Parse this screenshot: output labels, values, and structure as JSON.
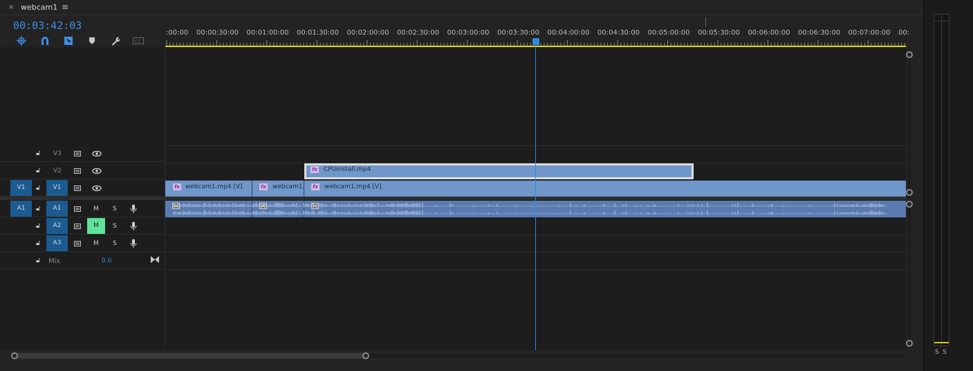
{
  "tab": {
    "title": "webcam1",
    "close_glyph": "×",
    "menu_glyph": "≡"
  },
  "timecode": "00:03:42:03",
  "toolbar_icons": [
    "nest-icon",
    "snap-magnet-icon",
    "linked-selection-icon",
    "marker-icon",
    "wrench-icon",
    "captions-icon"
  ],
  "ruler": {
    "ticks": [
      ":00:00",
      "00:00:30:00",
      "00:01:00:00",
      "00:01:30:00",
      "00:02:00:00",
      "00:02:30:00",
      "00:03:00:00",
      "00:03:30:00",
      "00:04:00:00",
      "00:04:30:00",
      "00:05:00:00",
      "00:05:30:00",
      "00:06:00:00",
      "00:06:30:00",
      "00:07:00:00",
      "00:"
    ]
  },
  "tracks": {
    "video": [
      {
        "name": "V3",
        "target": ""
      },
      {
        "name": "V2",
        "target": ""
      },
      {
        "name": "V1",
        "target": "V1"
      }
    ],
    "audio": [
      {
        "name": "A1",
        "target": "A1",
        "m": "M",
        "s": "S",
        "m_on": false
      },
      {
        "name": "A2",
        "target": "",
        "m": "M",
        "s": "S",
        "m_on": true
      },
      {
        "name": "A3",
        "target": "",
        "m": "M",
        "s": "S",
        "m_on": false
      }
    ],
    "mix": {
      "label": "Mix",
      "value": "0.0"
    }
  },
  "clips": {
    "v2": [
      {
        "label": "CPUinstall.mp4",
        "fx": "fx"
      }
    ],
    "v1": [
      {
        "label": "webcam1.mp4 [V]",
        "fx": "fx"
      },
      {
        "label": "webcam1.",
        "fx": "fx"
      },
      {
        "label": "webcam1.mp4 [V]",
        "fx": "fx"
      }
    ]
  },
  "meter": {
    "solo_labels": [
      "S",
      "S"
    ]
  },
  "colors": {
    "accent": "#2f8be0",
    "clip_video": "#6f97c9",
    "clip_audio": "#5a7bb0",
    "mute_on": "#5fe29a",
    "playhead": "#2f8be0",
    "work_area": "#e4d60b"
  }
}
